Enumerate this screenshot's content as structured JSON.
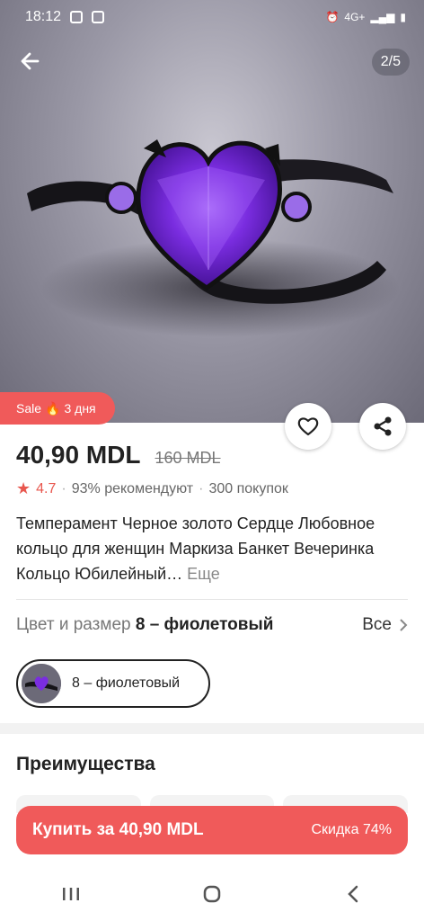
{
  "status_bar": {
    "time": "18:12",
    "network": "4G+"
  },
  "gallery": {
    "counter": "2/5"
  },
  "sale_badge": {
    "label": "Sale",
    "emoji": "🔥",
    "duration": "3 дня"
  },
  "product": {
    "price": "40,90 MDL",
    "old_price": "160 MDL",
    "rating": "4.7",
    "recommend": "93% рекомендуют",
    "purchases": "300 покупок",
    "title": "Темперамент Черное золото Сердце Любовное кольцо для женщин Маркиза Банкет Вечеринка Кольцо Юбилейный…",
    "more_label": "Еще"
  },
  "variant": {
    "label": "Цвет и размер",
    "value": "8 – фиолетовый",
    "all_label": "Все",
    "chip_label": "8 – фиолетовый"
  },
  "advantages": {
    "title": "Преимущества"
  },
  "buy_bar": {
    "buy_label": "Купить за 40,90 MDL",
    "discount_label": "Скидка 74%"
  },
  "colors": {
    "accent": "#f05a5a",
    "rating": "#e8574e",
    "gem": "#7a2de0"
  },
  "icons": [
    "back-arrow-icon",
    "heart-icon",
    "share-icon",
    "star-icon",
    "fire-icon",
    "chevron-right-icon",
    "recents-icon",
    "home-icon",
    "back-icon"
  ]
}
